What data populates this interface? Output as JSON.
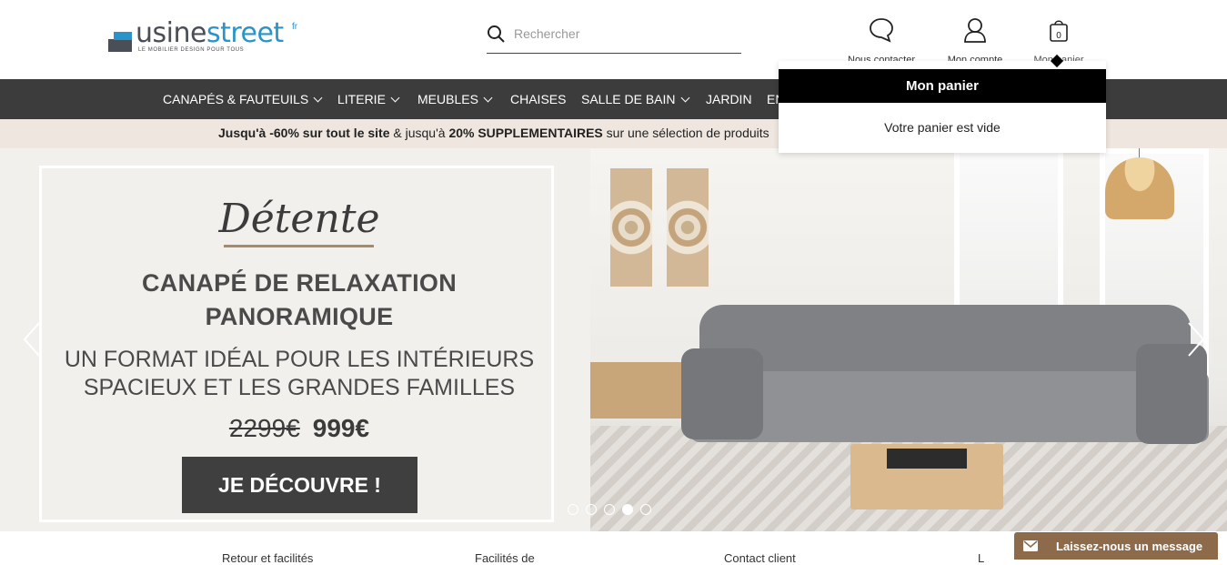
{
  "header": {
    "logo": {
      "text_main": "usine",
      "text_accent": "street",
      "suffix": "fr",
      "tagline": "LE MOBILIER DESIGN POUR TOUS"
    },
    "search": {
      "placeholder": "Rechercher"
    },
    "contact_label": "Nous contacter",
    "account_label": "Mon compte",
    "cart_label": "Mon panier",
    "cart_count": "0"
  },
  "nav": {
    "items": [
      {
        "label": "CANAPÉS & FAUTEUILS"
      },
      {
        "label": "LITERIE"
      },
      {
        "label": "MEUBLES"
      },
      {
        "label": "CHAISES"
      },
      {
        "label": "SALLE DE BAIN"
      },
      {
        "label": "JARDIN"
      },
      {
        "label": "EN"
      }
    ]
  },
  "promo": {
    "part1": "Jusqu'à -60% sur tout le site",
    "part2": " & jusqu'à ",
    "part3": "20% SUPPLEMENTAIRES",
    "part4": " sur une sélection de produits"
  },
  "cart_popup": {
    "title": "Mon panier",
    "empty_text": "Votre panier est vide"
  },
  "hero": {
    "script": "Détente",
    "headline_line1": "CANAPÉ DE RELAXATION",
    "headline_line2": "PANORAMIQUE",
    "sub_line1": "UN FORMAT IDÉAL POUR LES INTÉRIEURS",
    "sub_line2": "SPACIEUX ET LES GRANDES FAMILLES",
    "old_price": "2299€",
    "new_price": "999€",
    "cta": "JE DÉCOUVRE !",
    "slides_total": 5,
    "active_slide": 4
  },
  "bottom": {
    "items": [
      "Retour et facilités",
      "Facilités de",
      "Contact client",
      "L"
    ]
  },
  "chat": {
    "label": "Laissez-nous un message"
  },
  "colors": {
    "accent": "#2a93c7",
    "nav_bg": "#3c3c3c",
    "promo_bg": "#efe7df",
    "chat_bg": "#8d6b4a"
  }
}
